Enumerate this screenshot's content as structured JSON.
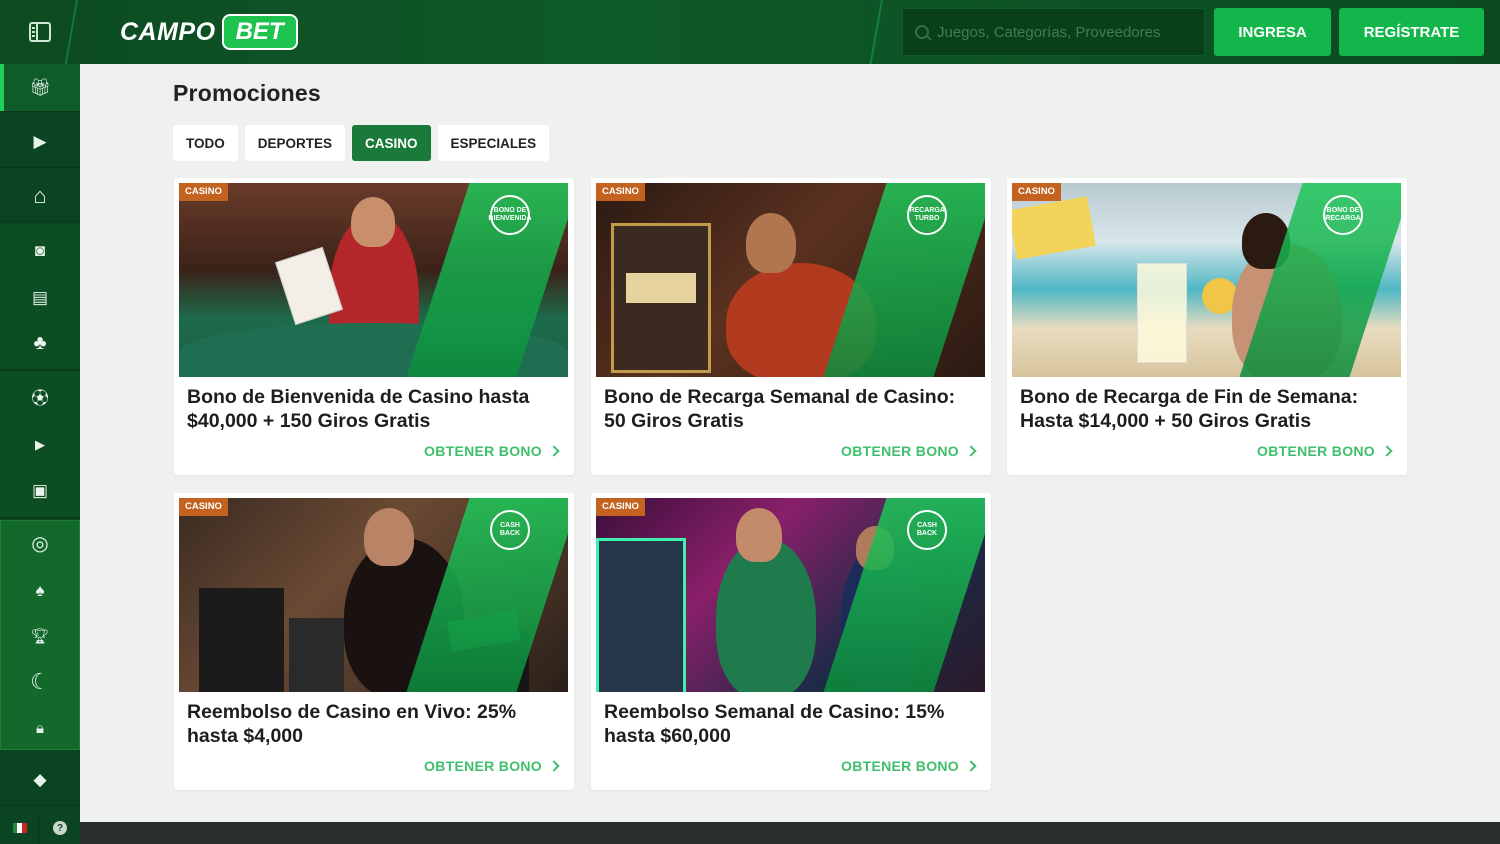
{
  "header": {
    "logo_left": "CAMPO",
    "logo_right": "BET",
    "search_placeholder": "Juegos, Categorías, Proveedores",
    "login_label": "INGRESA",
    "register_label": "REGÍSTRATE"
  },
  "sidebar": {
    "items": [
      {
        "icon": "gift-icon",
        "glyph": "🎁︎"
      },
      {
        "icon": "play-square-icon",
        "glyph": "▶"
      },
      {
        "icon": "home-icon",
        "glyph": "⌂"
      },
      {
        "icon": "slot-icon",
        "glyph": "◙"
      },
      {
        "icon": "live-casino-icon",
        "glyph": "▤"
      },
      {
        "icon": "clover-icon",
        "glyph": "♣"
      },
      {
        "icon": "soccer-ball-icon",
        "glyph": "⚽︎"
      },
      {
        "icon": "video-icon",
        "glyph": "▶"
      },
      {
        "icon": "esports-icon",
        "glyph": "▣"
      },
      {
        "icon": "target-icon",
        "glyph": "◎"
      },
      {
        "icon": "cards-icon",
        "glyph": "♠"
      },
      {
        "icon": "trophy-icon",
        "glyph": "🏆︎"
      },
      {
        "icon": "lightning-icon",
        "glyph": "☾"
      },
      {
        "icon": "lock-icon",
        "glyph": "🔒︎"
      },
      {
        "icon": "diamond-icon",
        "glyph": "◆"
      }
    ],
    "help_label": "?"
  },
  "main": {
    "title": "Promociones",
    "tabs": [
      {
        "label": "TODO",
        "active": false
      },
      {
        "label": "DEPORTES",
        "active": false
      },
      {
        "label": "CASINO",
        "active": true
      },
      {
        "label": "ESPECIALES",
        "active": false
      }
    ],
    "cards": [
      {
        "tag": "CASINO",
        "badge": "BONO DE BIENVENIDA",
        "title": "Bono de Bienvenida de Casino hasta $40,000 + 150 Giros Gratis",
        "cta": "OBTENER BONO"
      },
      {
        "tag": "CASINO",
        "badge": "RECARGA TURBO",
        "title": "Bono de Recarga Semanal de Casino: 50 Giros Gratis",
        "cta": "OBTENER BONO"
      },
      {
        "tag": "CASINO",
        "badge": "BONO DE RECARGA",
        "title": "Bono de Recarga de Fin de Semana: Hasta $14,000 + 50 Giros Gratis",
        "cta": "OBTENER BONO"
      },
      {
        "tag": "CASINO",
        "badge": "CASH BACK",
        "title": "Reembolso de Casino en Vivo: 25% hasta $4,000",
        "cta": "OBTENER BONO"
      },
      {
        "tag": "CASINO",
        "badge": "CASH BACK",
        "title": "Reembolso Semanal de Casino: 15% hasta $60,000",
        "cta": "OBTENER BONO"
      }
    ]
  }
}
